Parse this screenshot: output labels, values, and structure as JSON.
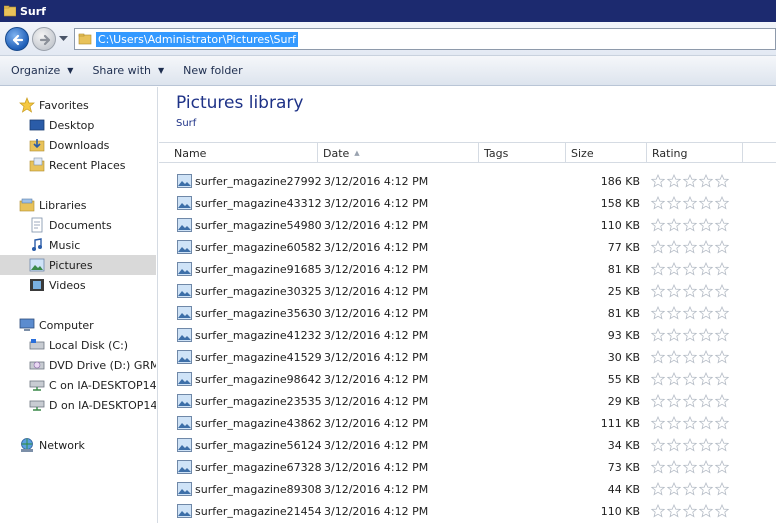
{
  "window": {
    "title": "Surf"
  },
  "address": {
    "path": "C:\\Users\\Administrator\\Pictures\\Surf"
  },
  "toolbar": {
    "organize": "Organize",
    "share_with": "Share with",
    "new_folder": "New folder"
  },
  "nav": {
    "favorites": "Favorites",
    "desktop": "Desktop",
    "downloads": "Downloads",
    "recent_places": "Recent Places",
    "libraries": "Libraries",
    "documents": "Documents",
    "music": "Music",
    "pictures": "Pictures",
    "videos": "Videos",
    "computer": "Computer",
    "local_disk": "Local Disk (C:)",
    "dvd_drive": "DVD Drive (D:) GRMSX",
    "c_on_desktop": "C on IA-DESKTOP14",
    "d_on_desktop": "D on IA-DESKTOP14",
    "network": "Network"
  },
  "library": {
    "title": "Pictures library",
    "subtitle": "Surf"
  },
  "columns": {
    "name": "Name",
    "date": "Date",
    "tags": "Tags",
    "size": "Size",
    "rating": "Rating"
  },
  "files": [
    {
      "name": "surfer_magazine27992",
      "date": "3/12/2016 4:12 PM",
      "size": "186 KB"
    },
    {
      "name": "surfer_magazine43312",
      "date": "3/12/2016 4:12 PM",
      "size": "158 KB"
    },
    {
      "name": "surfer_magazine54980",
      "date": "3/12/2016 4:12 PM",
      "size": "110 KB"
    },
    {
      "name": "surfer_magazine60582",
      "date": "3/12/2016 4:12 PM",
      "size": "77 KB"
    },
    {
      "name": "surfer_magazine91685",
      "date": "3/12/2016 4:12 PM",
      "size": "81 KB"
    },
    {
      "name": "surfer_magazine30325",
      "date": "3/12/2016 4:12 PM",
      "size": "25 KB"
    },
    {
      "name": "surfer_magazine35630",
      "date": "3/12/2016 4:12 PM",
      "size": "81 KB"
    },
    {
      "name": "surfer_magazine41232",
      "date": "3/12/2016 4:12 PM",
      "size": "93 KB"
    },
    {
      "name": "surfer_magazine41529",
      "date": "3/12/2016 4:12 PM",
      "size": "30 KB"
    },
    {
      "name": "surfer_magazine98642",
      "date": "3/12/2016 4:12 PM",
      "size": "55 KB"
    },
    {
      "name": "surfer_magazine23535",
      "date": "3/12/2016 4:12 PM",
      "size": "29 KB"
    },
    {
      "name": "surfer_magazine43862",
      "date": "3/12/2016 4:12 PM",
      "size": "111 KB"
    },
    {
      "name": "surfer_magazine56124",
      "date": "3/12/2016 4:12 PM",
      "size": "34 KB"
    },
    {
      "name": "surfer_magazine67328",
      "date": "3/12/2016 4:12 PM",
      "size": "73 KB"
    },
    {
      "name": "surfer_magazine89308",
      "date": "3/12/2016 4:12 PM",
      "size": "44 KB"
    },
    {
      "name": "surfer_magazine21454",
      "date": "3/12/2016 4:12 PM",
      "size": "110 KB"
    }
  ],
  "colors": {
    "titlebar": "#1c2a6f",
    "selection": "#3399ff",
    "library_title": "#1e3287"
  }
}
